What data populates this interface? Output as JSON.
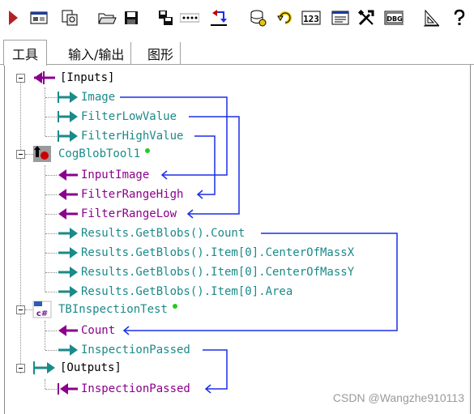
{
  "toolbar": {
    "buttons": [
      "run-icon",
      "display-icon",
      "copy-config-icon",
      "open-folder-icon",
      "save-icon",
      "save-as-icon",
      "ellipsis-icon",
      "import-icon",
      "database-icon",
      "refresh-icon",
      "numeric-123-icon",
      "list-icon",
      "tools-icon",
      "debug-icon",
      "measure-icon",
      "help-icon"
    ],
    "numeric_label": "123",
    "debug_label": "DBG"
  },
  "tabs": [
    {
      "label": "工具"
    },
    {
      "label": "输入/输出"
    },
    {
      "label": "图形"
    }
  ],
  "tree": {
    "inputs": "[Inputs]",
    "image": "Image",
    "filter_low": "FilterLowValue",
    "filter_high": "FilterHighValue",
    "blob_tool": "CogBlobTool1",
    "input_image": "InputImage",
    "filter_range_high": "FilterRangeHigh",
    "filter_range_low": "FilterRangeLow",
    "result_count": "Results.GetBlobs().Count",
    "result_cx": "Results.GetBlobs().Item[0].CenterOfMassX",
    "result_cy": "Results.GetBlobs().Item[0].CenterOfMassY",
    "result_area": "Results.GetBlobs().Item[0].Area",
    "inspection_test": "TBInspectionTest",
    "count": "Count",
    "inspection_passed": "InspectionPassed",
    "outputs": "[Outputs]",
    "outputs_inspection_passed": "InspectionPassed"
  },
  "colors": {
    "teal": "#1b8a8a",
    "purple": "#8b008b",
    "link_blue": "#1a2ee8",
    "status_green": "#22cc22"
  },
  "watermark": "CSDN @Wangzhe910113"
}
